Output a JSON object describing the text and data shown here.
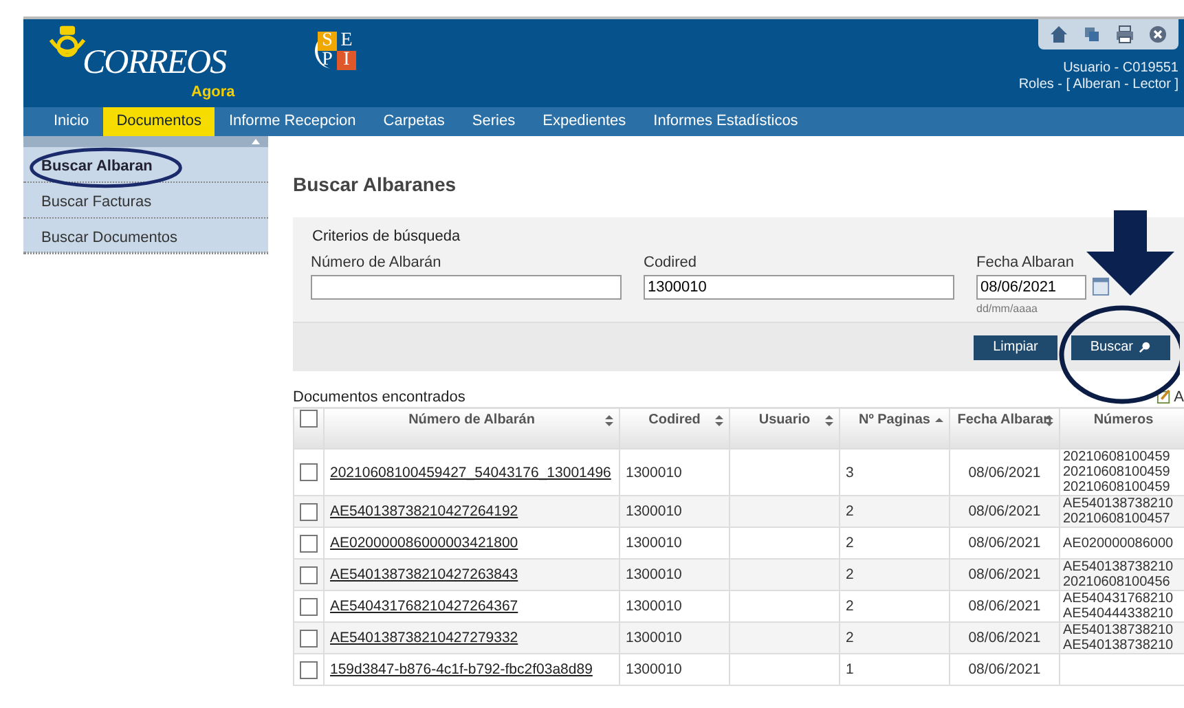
{
  "header": {
    "logo_text": "CORREOS",
    "logo_sub": "Agora",
    "partner_logo": [
      "S",
      "E",
      "P",
      "I"
    ],
    "user": "Usuario - C019551",
    "roles": "Roles - [ Alberan - Lector ]"
  },
  "nav": [
    {
      "label": "Inicio",
      "selected": false
    },
    {
      "label": "Documentos",
      "selected": true
    },
    {
      "label": "Informe Recepcion",
      "selected": false
    },
    {
      "label": "Carpetas",
      "selected": false
    },
    {
      "label": "Series",
      "selected": false
    },
    {
      "label": "Expedientes",
      "selected": false
    },
    {
      "label": "Informes Estadísticos",
      "selected": false
    }
  ],
  "sidebar": {
    "items": [
      {
        "label": "Buscar Albaran",
        "selected": true
      },
      {
        "label": "Buscar Facturas",
        "selected": false
      },
      {
        "label": "Buscar Documentos",
        "selected": false
      }
    ]
  },
  "page_title": "Buscar Albaranes",
  "search": {
    "title": "Criterios de búsqueda",
    "fields": [
      {
        "label": "Número de Albarán"
      },
      {
        "label": "Codired",
        "value": "1300010"
      },
      {
        "label": "Fecha Albaran",
        "value": "08/06/2021",
        "hint": "dd/mm/aaaa"
      }
    ],
    "buttons": [
      "Limpiar",
      "Buscar"
    ]
  },
  "results": {
    "title": "Documentos encontrados",
    "action": "A",
    "all_checked": false,
    "columns": [
      "Número de Albarán",
      "Codired",
      "Usuario",
      "Nº Paginas",
      "Fecha Albaran",
      "Números"
    ],
    "rows": [
      {
        "checked": false,
        "numero": "20210608100459427_54043176_13001496",
        "codired": "1300010",
        "paginas": "3",
        "fecha": "08/06/2021",
        "numeros": [
          "20210608100459",
          "20210608100459",
          "20210608100459"
        ]
      },
      {
        "checked": false,
        "numero": "AE540138738210427264192",
        "codired": "1300010",
        "paginas": "2",
        "fecha": "08/06/2021",
        "numeros": [
          "AE540138738210",
          "20210608100457"
        ]
      },
      {
        "checked": false,
        "numero": "AE020000086000003421800",
        "codired": "1300010",
        "paginas": "2",
        "fecha": "08/06/2021",
        "numeros": [
          "AE020000086000"
        ]
      },
      {
        "checked": false,
        "numero": "AE540138738210427263843",
        "codired": "1300010",
        "paginas": "2",
        "fecha": "08/06/2021",
        "numeros": [
          "AE540138738210",
          "20210608100456"
        ]
      },
      {
        "checked": false,
        "numero": "AE540431768210427264367",
        "codired": "1300010",
        "paginas": "2",
        "fecha": "08/06/2021",
        "numeros": [
          "AE540431768210",
          "AE540444338210"
        ]
      },
      {
        "checked": false,
        "numero": "AE540138738210427279332",
        "codired": "1300010",
        "paginas": "2",
        "fecha": "08/06/2021",
        "numeros": [
          "AE540138738210",
          "AE540138738210"
        ]
      },
      {
        "checked": false,
        "numero": "159d3847-b876-4c1f-b792-fbc2f03a8d89",
        "codired": "1300010",
        "paginas": "1",
        "fecha": "08/06/2021",
        "numeros": []
      }
    ]
  }
}
